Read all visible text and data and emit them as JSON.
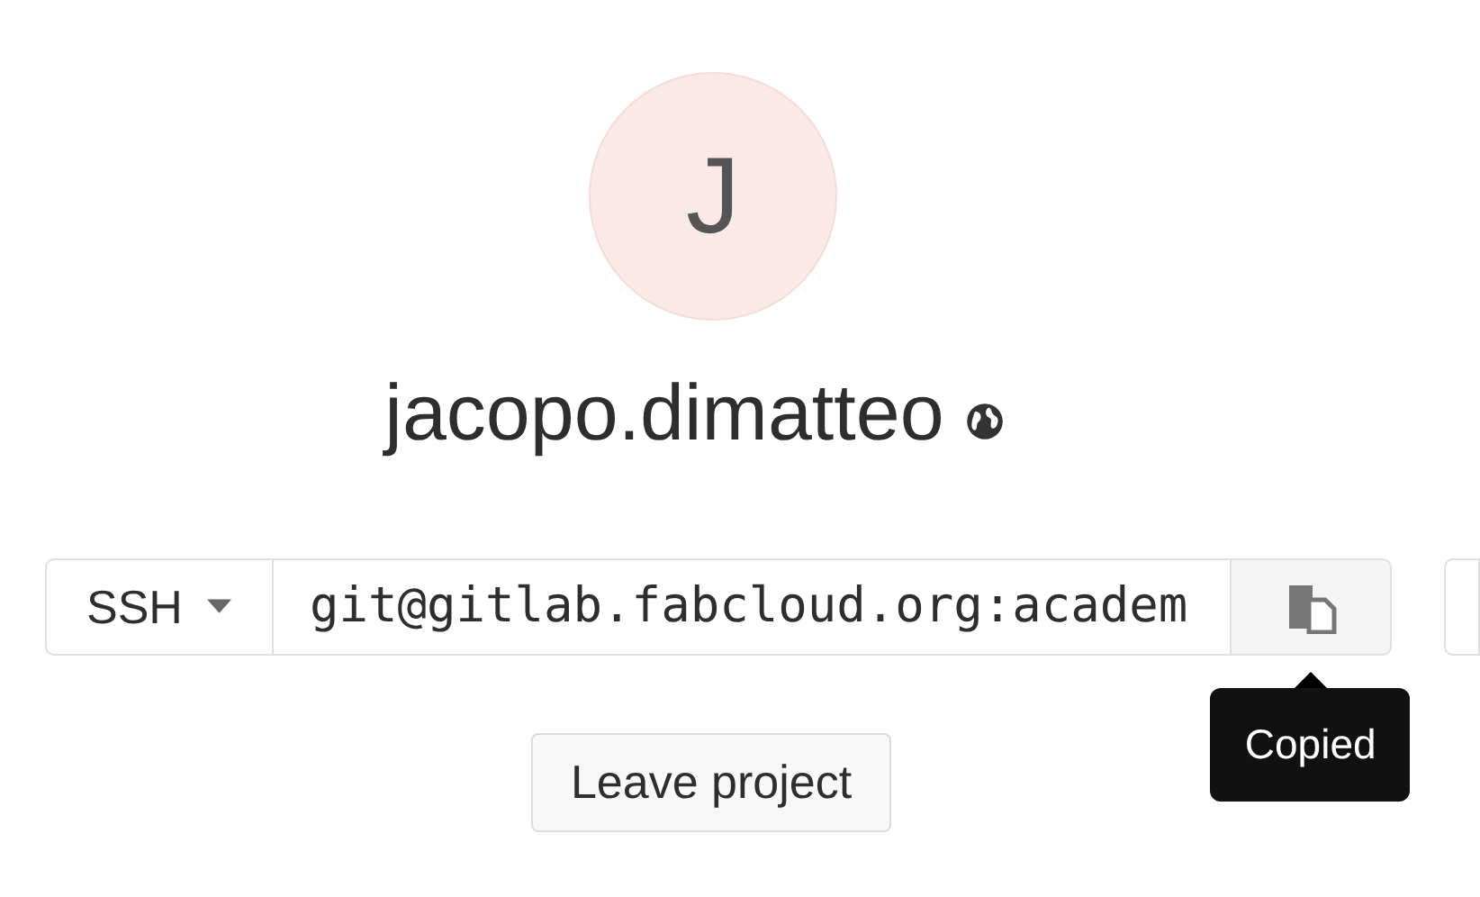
{
  "avatar": {
    "initial": "J"
  },
  "user": {
    "name": "jacopo.dimatteo"
  },
  "clone": {
    "protocol": "SSH",
    "url": "git@gitlab.fabcloud.org:academ",
    "tooltip": "Copied"
  },
  "buttons": [
    {
      "label": "Leave project"
    }
  ]
}
